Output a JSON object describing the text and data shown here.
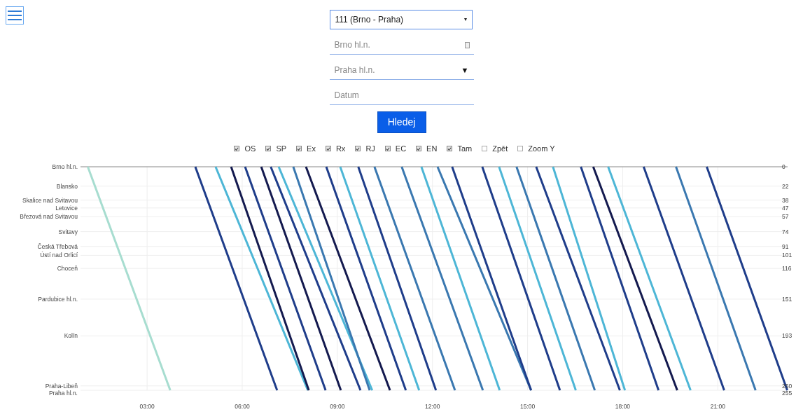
{
  "route_select": {
    "value": "111 (Brno - Praha)"
  },
  "from_field": {
    "placeholder": "Brno hl.n."
  },
  "to_field": {
    "placeholder": "Praha hl.n.",
    "arrow": "▼"
  },
  "date_field": {
    "placeholder": "Datum"
  },
  "search_button": "Hledej",
  "filters": [
    {
      "label": "OS",
      "checked": true
    },
    {
      "label": "SP",
      "checked": true
    },
    {
      "label": "Ex",
      "checked": true
    },
    {
      "label": "Rx",
      "checked": true
    },
    {
      "label": "RJ",
      "checked": true
    },
    {
      "label": "EC",
      "checked": true
    },
    {
      "label": "EN",
      "checked": true
    },
    {
      "label": "Tam",
      "checked": true
    },
    {
      "label": "Zpět",
      "checked": false
    },
    {
      "label": "Zoom Y",
      "checked": false
    }
  ],
  "station_axis": [
    "Brno hl.n.",
    "Blansko",
    "Skalice nad Svitavou",
    "Letovice",
    "Březová nad Svitavou",
    "Svitavy",
    "Česká Třebová",
    "Ústí nad Orlicí",
    "Choceň",
    "Pardubice hl.n.",
    "Kolín",
    "Praha-Libeň",
    "Praha hl.n."
  ],
  "chart_data": {
    "type": "line",
    "grid": true,
    "orientation": "horizontal",
    "x": [
      0,
      255
    ],
    "xlim": [
      0.9,
      23.2
    ],
    "ylim": [
      255,
      0
    ],
    "xticks": [
      {
        "value": 3,
        "label": "03:00"
      },
      {
        "value": 6,
        "label": "06:00"
      },
      {
        "value": 9,
        "label": "09:00"
      },
      {
        "value": 12,
        "label": "12:00"
      },
      {
        "value": 15,
        "label": "15:00"
      },
      {
        "value": 18,
        "label": "18:00"
      },
      {
        "value": 21,
        "label": "21:00"
      }
    ],
    "yticks": [
      0,
      22,
      38,
      47,
      57,
      74,
      91,
      101,
      116,
      151,
      193,
      250,
      255
    ],
    "series": [
      {
        "color": "#a7ddd0",
        "values": [
          1.13,
          3.73
        ]
      },
      {
        "color": "#1f3d8a",
        "values": [
          4.52,
          7.1
        ]
      },
      {
        "color": "#4db6d6",
        "values": [
          5.16,
          8.07
        ]
      },
      {
        "color": "#141a4f",
        "values": [
          5.65,
          8.1
        ]
      },
      {
        "color": "#1f3d8a",
        "values": [
          6.09,
          8.63
        ]
      },
      {
        "color": "#141a4f",
        "values": [
          6.6,
          9.11
        ]
      },
      {
        "color": "#1f3d8a",
        "values": [
          6.9,
          9.73
        ]
      },
      {
        "color": "#4db6d6",
        "values": [
          7.15,
          10.1
        ]
      },
      {
        "color": "#3a78b0",
        "values": [
          7.61,
          10.02
        ]
      },
      {
        "color": "#141a4f",
        "values": [
          8.01,
          10.66
        ]
      },
      {
        "color": "#1f3d8a",
        "values": [
          8.65,
          11.16
        ]
      },
      {
        "color": "#4db6d6",
        "values": [
          9.09,
          11.58
        ]
      },
      {
        "color": "#1f3d8a",
        "values": [
          9.66,
          12.11
        ]
      },
      {
        "color": "#3a78b0",
        "values": [
          10.17,
          12.71
        ]
      },
      {
        "color": "#3a78b0",
        "values": [
          11.03,
          13.59
        ]
      },
      {
        "color": "#4db6d6",
        "values": [
          11.65,
          14.12
        ]
      },
      {
        "color": "#3a78b0",
        "values": [
          12.16,
          15.11
        ]
      },
      {
        "color": "#1f3d8a",
        "values": [
          12.62,
          15.11
        ]
      },
      {
        "color": "#1f3d8a",
        "values": [
          13.57,
          16.02
        ]
      },
      {
        "color": "#4db6d6",
        "values": [
          14.1,
          16.52
        ]
      },
      {
        "color": "#3a78b0",
        "values": [
          14.65,
          17.12
        ]
      },
      {
        "color": "#1f3d8a",
        "values": [
          15.27,
          17.91
        ]
      },
      {
        "color": "#4db6d6",
        "values": [
          15.8,
          18.07
        ]
      },
      {
        "color": "#1f3d8a",
        "values": [
          16.68,
          19.13
        ]
      },
      {
        "color": "#141a4f",
        "values": [
          17.07,
          19.72
        ]
      },
      {
        "color": "#4db6d6",
        "values": [
          17.54,
          20.14
        ]
      },
      {
        "color": "#1f3d8a",
        "values": [
          18.66,
          21.2
        ]
      },
      {
        "color": "#3a78b0",
        "values": [
          19.68,
          22.19
        ]
      },
      {
        "color": "#1f3d8a",
        "values": [
          20.65,
          23.19
        ]
      }
    ]
  }
}
